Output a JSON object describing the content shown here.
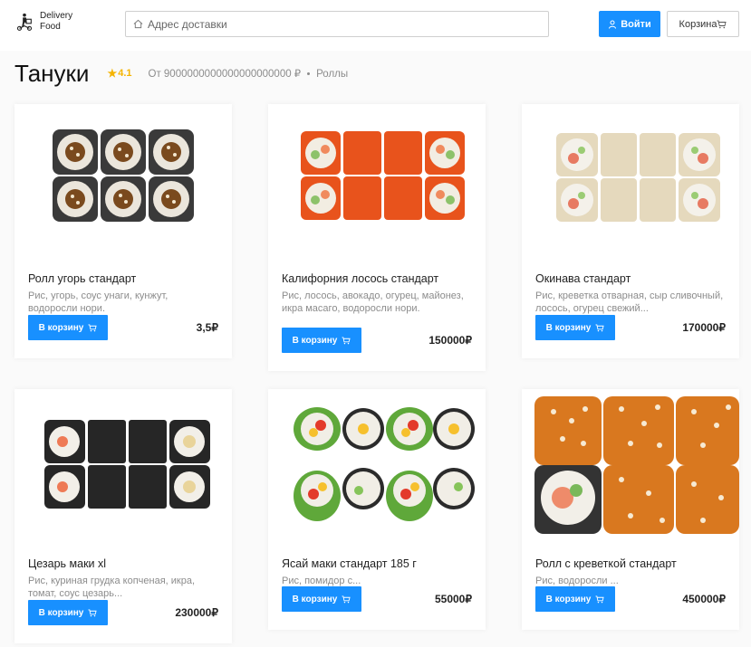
{
  "header": {
    "logo_line1": "Delivery",
    "logo_line2": "Food",
    "search_placeholder": "Адрес доставки",
    "login_label": "Войти",
    "cart_label": "Корзина"
  },
  "restaurant": {
    "name": "Тануки",
    "rating": "4.1",
    "price": "От 9000000000000000000000 ₽",
    "category": "Роллы"
  },
  "colors": {
    "accent": "#1890ff",
    "star": "#f5b400"
  },
  "products": [
    {
      "name": "Ролл угорь стандарт",
      "desc": "Рис, угорь, соус унаги, кунжут, водоросли нори.",
      "button": "В корзину",
      "price": "3,5₽"
    },
    {
      "name": "Калифорния лосось стандарт",
      "desc": "Рис, лосось, авокадо, огурец, майонез, икра масаго, водоросли нори.",
      "button": "В корзину",
      "price": "150000₽"
    },
    {
      "name": "Окинава стандарт",
      "desc": "Рис, креветка отварная, сыр сливочный, лосось, огурец свежий...",
      "button": "В корзину",
      "price": "170000₽"
    },
    {
      "name": "Цезарь маки xl",
      "desc": "Рис, куриная грудка копченая, икра, томат, соус цезарь...",
      "button": "В корзину",
      "price": "230000₽"
    },
    {
      "name": "Ясай маки стандарт 185 г",
      "desc": "Рис, помидор с...",
      "button": "В корзину",
      "price": "55000₽"
    },
    {
      "name": "Ролл с креветкой стандарт",
      "desc": "Рис, водоросли ...",
      "button": "В корзину",
      "price": "450000₽"
    }
  ]
}
